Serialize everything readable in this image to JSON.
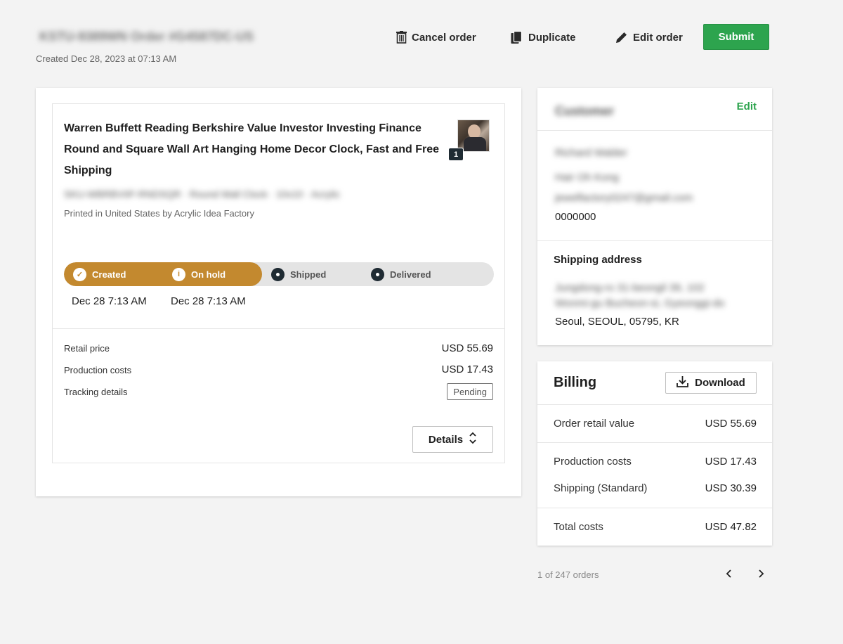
{
  "header": {
    "order_title": "KSTU-9389WN Order #G4587DC-US",
    "created": "Created Dec 28, 2023 at 07:13 AM",
    "cancel_label": "Cancel order",
    "duplicate_label": "Duplicate",
    "edit_label": "Edit order",
    "submit_label": "Submit",
    "submit_color": "#2da44e"
  },
  "item": {
    "title": "Warren Buffett Reading Berkshire Value Investor Investing Finance Round and Square Wall Art Hanging Home Decor Clock, Fast and Free Shipping",
    "quantity": "1",
    "sku": "SKU-WBRBVIIF-RNDSQR · Round Wall Clock · 10x10 · Acrylic",
    "printed_by": "Printed in United States by Acrylic Idea Factory",
    "thumb_icon": "product-thumbnail"
  },
  "tracking": {
    "accent": "#c3892f",
    "steps": [
      {
        "label": "Created",
        "state": "done",
        "date": "Dec 28 7:13 AM"
      },
      {
        "label": "On hold",
        "state": "done",
        "date": "Dec 28 7:13 AM"
      },
      {
        "label": "Shipped",
        "state": "todo",
        "date": ""
      },
      {
        "label": "Delivered",
        "state": "todo",
        "date": ""
      }
    ]
  },
  "costs": {
    "retail_label": "Retail price",
    "retail_value": "USD 55.69",
    "production_label": "Production costs",
    "production_value": "USD 17.43",
    "tracking_label": "Tracking details",
    "tracking_status": "Pending",
    "details_label": "Details"
  },
  "customer": {
    "title": "Customer",
    "edit_label": "Edit",
    "name": "Richard Walder",
    "company": "Hair Oh Kong",
    "email": "jewelfactory0247@gmail.com",
    "phone": "0000000",
    "shipping_title": "Shipping address",
    "address_line1": "Jungdong-ro 31-beongil 39, 102",
    "address_line2": "Wonmi-gu Bucheon-si, Gyeonggi-do",
    "address_city": "Seoul, SEOUL, 05795, KR"
  },
  "billing": {
    "title": "Billing",
    "download_label": "Download",
    "retail_label": "Order retail value",
    "retail_value": "USD 55.69",
    "production_label": "Production costs",
    "production_value": "USD 17.43",
    "shipping_label": "Shipping (Standard)",
    "shipping_value": "USD 30.39",
    "total_label": "Total costs",
    "total_value": "USD 47.82"
  },
  "pagination": {
    "text": "1 of 247 orders"
  }
}
